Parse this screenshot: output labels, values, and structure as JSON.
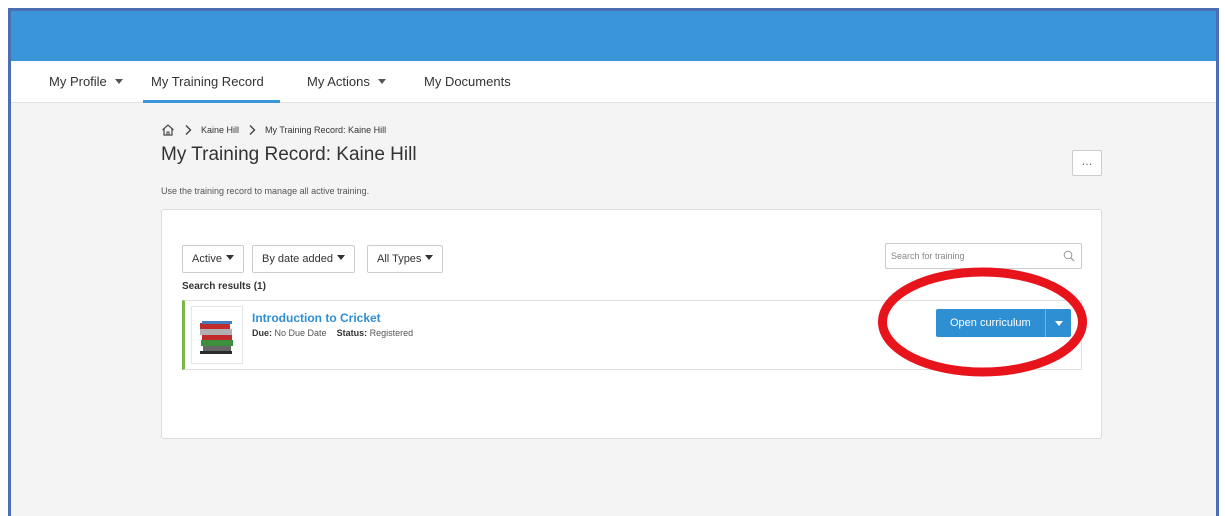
{
  "nav": {
    "items": [
      {
        "label": "My Profile",
        "dropdown": true
      },
      {
        "label": "My Training Record",
        "dropdown": false,
        "active": true
      },
      {
        "label": "My Actions",
        "dropdown": true
      },
      {
        "label": "My Documents",
        "dropdown": false
      }
    ]
  },
  "breadcrumb": {
    "items": [
      "Kaine Hill",
      "My Training Record: Kaine Hill"
    ]
  },
  "page": {
    "title": "My Training Record: Kaine Hill",
    "subtitle": "Use the training record to manage all active training.",
    "more_label": "…"
  },
  "filters": {
    "status": "Active",
    "sort": "By date added",
    "type": "All Types"
  },
  "search": {
    "placeholder": "Search for training"
  },
  "results": {
    "label": "Search results (1)",
    "items": [
      {
        "title": "Introduction to Cricket",
        "due_label": "Due:",
        "due_value": "No Due Date",
        "status_label": "Status:",
        "status_value": "Registered",
        "action_label": "Open curriculum"
      }
    ]
  },
  "colors": {
    "header": "#3a96d9",
    "accent": "#2f8fd3",
    "row_marker": "#7ab648",
    "annotation": "#e8141b"
  }
}
